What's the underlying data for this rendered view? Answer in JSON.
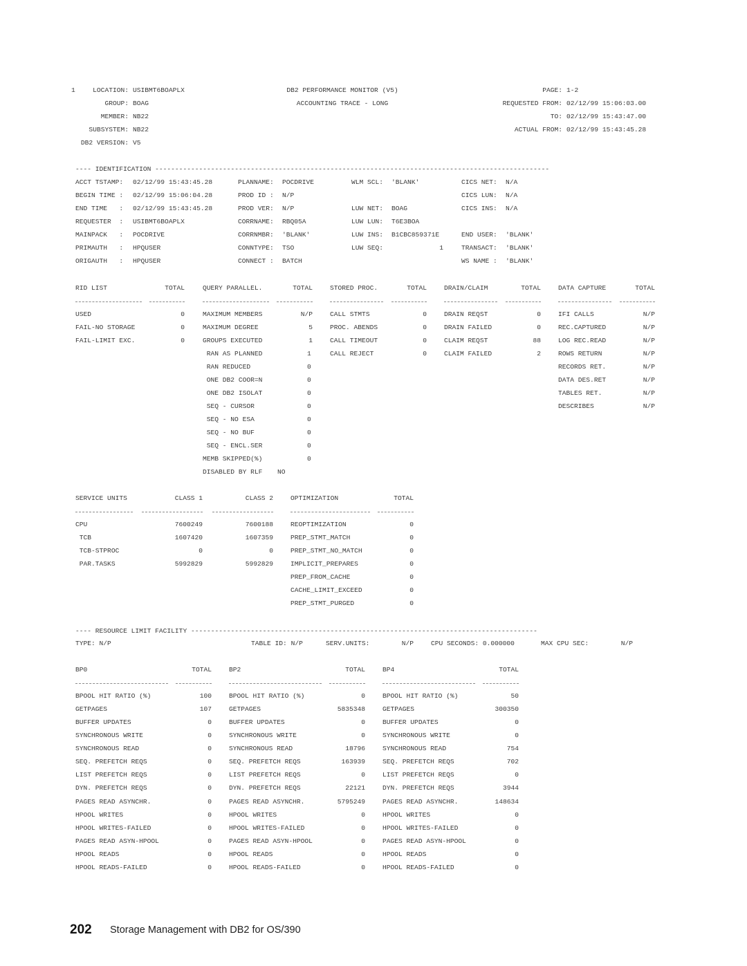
{
  "header": {
    "line_number": "1",
    "location_label": "LOCATION:",
    "location": "USIBMT6BOAPLX",
    "group_label": "GROUP:",
    "group": "BOAG",
    "member_label": "MEMBER:",
    "member": "NB22",
    "subsystem_label": "SUBSYSTEM:",
    "subsystem": "NB22",
    "version_label": "DB2 VERSION:",
    "version": "V5",
    "title": "DB2 PERFORMANCE MONITOR (V5)",
    "subtitle": "ACCOUNTING TRACE - LONG",
    "page_label": "PAGE:",
    "page": "1-2",
    "requested_from_label": "REQUESTED FROM:",
    "requested_from": "02/12/99 15:06:03.00",
    "to_label": "TO:",
    "to": "02/12/99 15:43:47.00",
    "actual_from_label": "ACTUAL FROM:",
    "actual_from": "02/12/99 15:43:45.28"
  },
  "identification": {
    "section_title": "---- IDENTIFICATION ---------------------------------------------------------------------------------------------------",
    "col1": [
      {
        "label": "ACCT TSTAMP:",
        "value": "02/12/99 15:43:45.28"
      },
      {
        "label": "BEGIN TIME :",
        "value": "02/12/99 15:06:04.28"
      },
      {
        "label": "END TIME   :",
        "value": "02/12/99 15:43:45.28"
      },
      {
        "label": "REQUESTER  :",
        "value": "USIBMT6BOAPLX"
      },
      {
        "label": "MAINPACK   :",
        "value": "POCDRIVE"
      },
      {
        "label": "PRIMAUTH   :",
        "value": "HPQUSER"
      },
      {
        "label": "ORIGAUTH   :",
        "value": "HPQUSER"
      }
    ],
    "col2": [
      {
        "label": "PLANNAME:",
        "value": "POCDRIVE"
      },
      {
        "label": "PROD ID :",
        "value": "N/P"
      },
      {
        "label": "PROD VER:",
        "value": "N/P"
      },
      {
        "label": "CORRNAME:",
        "value": "RBQ05A"
      },
      {
        "label": "CORRNMBR:",
        "value": "'BLANK'"
      },
      {
        "label": "CONNTYPE:",
        "value": "TSO"
      },
      {
        "label": "CONNECT :",
        "value": "BATCH"
      }
    ],
    "col3": [
      {
        "label": "WLM SCL:",
        "value": "'BLANK'"
      },
      {
        "label": "",
        "value": ""
      },
      {
        "label": "LUW NET:",
        "value": "BOAG"
      },
      {
        "label": "LUW LUN:",
        "value": "T6E3BOA"
      },
      {
        "label": "LUW INS:",
        "value": "B1CBC859371E"
      },
      {
        "label": "LUW SEQ:",
        "value": "1"
      },
      {
        "label": "",
        "value": ""
      }
    ],
    "col4": [
      {
        "label": "CICS NET:",
        "value": "N/A"
      },
      {
        "label": "CICS LUN:",
        "value": "N/A"
      },
      {
        "label": "CICS INS:",
        "value": "N/A"
      },
      {
        "label": "",
        "value": ""
      },
      {
        "label": "END USER:",
        "value": "'BLANK'"
      },
      {
        "label": "TRANSACT:",
        "value": "'BLANK'"
      },
      {
        "label": "WS NAME :",
        "value": "'BLANK'"
      }
    ]
  },
  "counters": {
    "rid_list": {
      "title": "RID LIST",
      "total": "TOTAL",
      "rows": [
        {
          "label": "USED",
          "value": "0"
        },
        {
          "label": "FAIL-NO STORAGE",
          "value": "0"
        },
        {
          "label": "FAIL-LIMIT EXC.",
          "value": "0"
        }
      ]
    },
    "query_parallel": {
      "title": "QUERY PARALLEL.",
      "total": "TOTAL",
      "rows": [
        {
          "label": "MAXIMUM MEMBERS",
          "value": "N/P"
        },
        {
          "label": "MAXIMUM DEGREE",
          "value": "5"
        },
        {
          "label": "GROUPS EXECUTED",
          "value": "1"
        },
        {
          "label": " RAN AS PLANNED",
          "value": "1"
        },
        {
          "label": " RAN REDUCED",
          "value": "0"
        },
        {
          "label": " ONE DB2 COOR=N",
          "value": "0"
        },
        {
          "label": " ONE DB2 ISOLAT",
          "value": "0"
        },
        {
          "label": " SEQ - CURSOR",
          "value": "0"
        },
        {
          "label": " SEQ - NO ESA",
          "value": "0"
        },
        {
          "label": " SEQ - NO BUF",
          "value": "0"
        },
        {
          "label": " SEQ - ENCL.SER",
          "value": "0"
        },
        {
          "label": "MEMB SKIPPED(%)",
          "value": "0"
        },
        {
          "label": "DISABLED BY RLF",
          "value": "NO"
        }
      ]
    },
    "stored_proc": {
      "title": "STORED PROC.",
      "total": "TOTAL",
      "rows": [
        {
          "label": "CALL STMTS",
          "value": "0"
        },
        {
          "label": "PROC. ABENDS",
          "value": "0"
        },
        {
          "label": "CALL TIMEOUT",
          "value": "0"
        },
        {
          "label": "CALL REJECT",
          "value": "0"
        }
      ]
    },
    "drain_claim": {
      "title": "DRAIN/CLAIM",
      "total": "TOTAL",
      "rows": [
        {
          "label": "DRAIN REQST",
          "value": "0"
        },
        {
          "label": "DRAIN FAILED",
          "value": "0"
        },
        {
          "label": "CLAIM REQST",
          "value": "88"
        },
        {
          "label": "CLAIM FAILED",
          "value": "2"
        }
      ]
    },
    "data_capture": {
      "title": "DATA CAPTURE",
      "total": "TOTAL",
      "rows": [
        {
          "label": "IFI CALLS",
          "value": "N/P"
        },
        {
          "label": "REC.CAPTURED",
          "value": "N/P"
        },
        {
          "label": "LOG REC.READ",
          "value": "N/P"
        },
        {
          "label": "ROWS RETURN",
          "value": "N/P"
        },
        {
          "label": "RECORDS RET.",
          "value": "N/P"
        },
        {
          "label": "DATA DES.RET",
          "value": "N/P"
        },
        {
          "label": "TABLES RET.",
          "value": "N/P"
        },
        {
          "label": "DESCRIBES",
          "value": "N/P"
        }
      ]
    }
  },
  "service_units": {
    "title": "SERVICE UNITS",
    "class1": "CLASS 1",
    "class2": "CLASS 2",
    "rows": [
      {
        "label": "CPU",
        "class1": "7600249",
        "class2": "7600188"
      },
      {
        "label": " TCB",
        "class1": "1607420",
        "class2": "1607359"
      },
      {
        "label": " TCB-STPROC",
        "class1": "0",
        "class2": "0"
      },
      {
        "label": " PAR.TASKS",
        "class1": "5992829",
        "class2": "5992829"
      }
    ]
  },
  "optimization": {
    "title": "OPTIMIZATION",
    "total": "TOTAL",
    "rows": [
      {
        "label": "REOPTIMIZATION",
        "value": "0"
      },
      {
        "label": "PREP_STMT_MATCH",
        "value": "0"
      },
      {
        "label": "PREP_STMT_NO_MATCH",
        "value": "0"
      },
      {
        "label": "IMPLICIT_PREPARES",
        "value": "0"
      },
      {
        "label": "PREP_FROM_CACHE",
        "value": "0"
      },
      {
        "label": "CACHE_LIMIT_EXCEED",
        "value": "0"
      },
      {
        "label": "PREP_STMT_PURGED",
        "value": "0"
      }
    ]
  },
  "rlf": {
    "section_title": "---- RESOURCE LIMIT FACILITY ---------------------------------------------------------------------------------------",
    "type": "TYPE: N/P",
    "table_id": "TABLE ID: N/P",
    "serv_units_label": "SERV.UNITS:",
    "serv_units": "N/P",
    "cpu_seconds": "CPU SECONDS: 0.000000",
    "max_cpu_label": "MAX CPU SEC:",
    "max_cpu": "N/P"
  },
  "buffer_pools": {
    "row_labels": [
      "BPOOL HIT RATIO (%)",
      "GETPAGES",
      "BUFFER UPDATES",
      "SYNCHRONOUS WRITE",
      "SYNCHRONOUS READ",
      "SEQ. PREFETCH REQS",
      "LIST PREFETCH REQS",
      "DYN. PREFETCH REQS",
      "PAGES READ ASYNCHR.",
      "HPOOL WRITES",
      "HPOOL WRITES-FAILED",
      "PAGES READ ASYN-HPOOL",
      "HPOOL READS",
      "HPOOL READS-FAILED"
    ],
    "total_label": "TOTAL",
    "pools": [
      {
        "name": "BP0",
        "values": [
          "100",
          "107",
          "0",
          "0",
          "0",
          "0",
          "0",
          "0",
          "0",
          "0",
          "0",
          "0",
          "0",
          "0"
        ]
      },
      {
        "name": "BP2",
        "values": [
          "0",
          "5835348",
          "0",
          "0",
          "18796",
          "163939",
          "0",
          "22121",
          "5795249",
          "0",
          "0",
          "0",
          "0",
          "0"
        ]
      },
      {
        "name": "BP4",
        "values": [
          "50",
          "300350",
          "0",
          "0",
          "754",
          "702",
          "0",
          "3944",
          "148634",
          "0",
          "0",
          "0",
          "0",
          "0"
        ]
      }
    ]
  },
  "footer": {
    "page_number": "202",
    "book_title": "Storage Management with DB2 for OS/390"
  }
}
